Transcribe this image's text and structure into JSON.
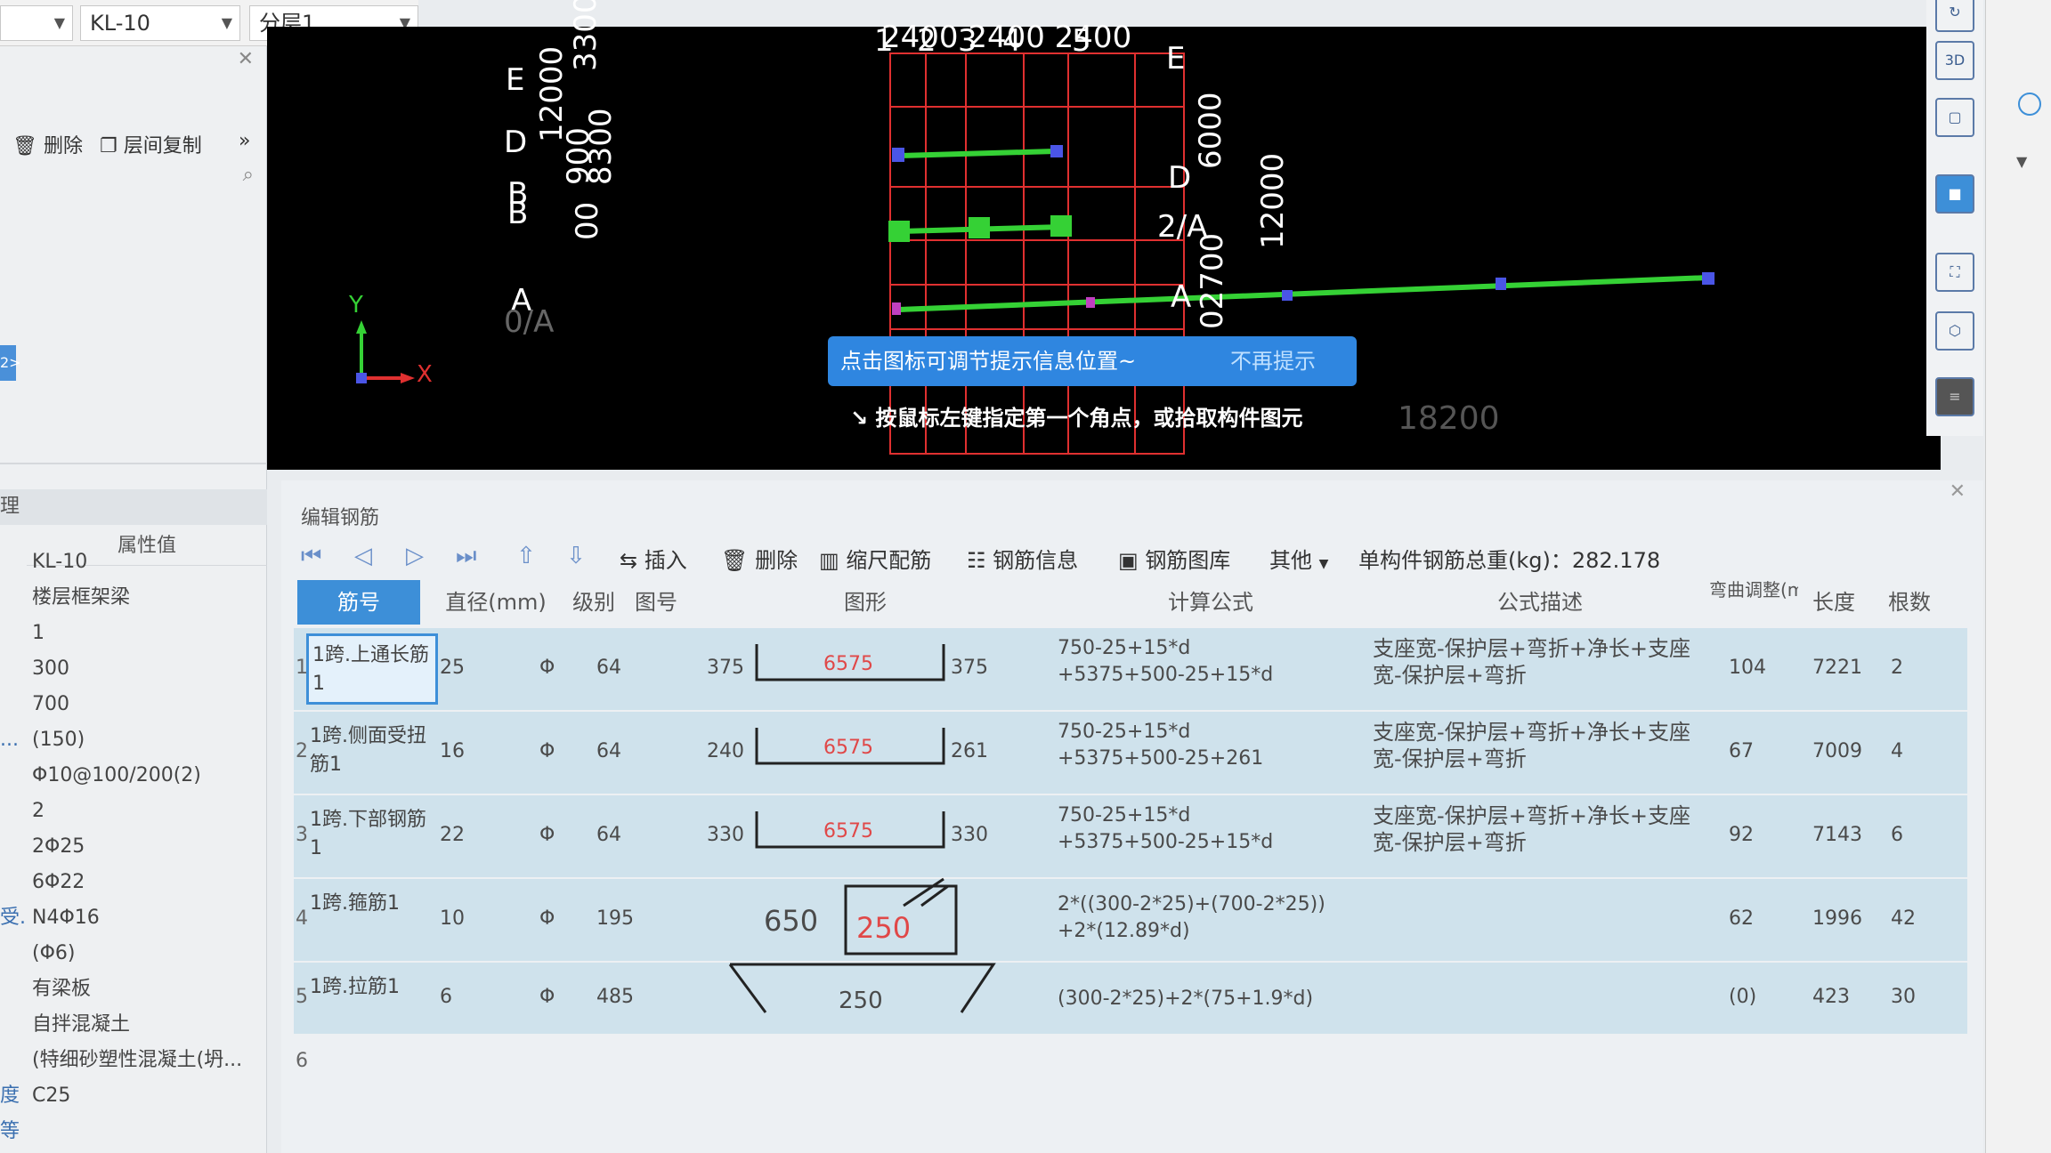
{
  "toolbar": {
    "combo_left_value": "",
    "combo_element": "KL-10",
    "combo_layer": "分层1"
  },
  "left_panel": {
    "delete_label": "删除",
    "copy_label": "层间复制",
    "tab_label": "2>",
    "section_label": "理",
    "col_header": "属性值",
    "properties": [
      {
        "label": "",
        "value": "KL-10"
      },
      {
        "label": "",
        "value": "楼层框架梁"
      },
      {
        "label": "",
        "value": "1"
      },
      {
        "label": "",
        "value": "300"
      },
      {
        "label": "",
        "value": "700"
      },
      {
        "label": "...",
        "value": "(150)"
      },
      {
        "label": "",
        "value": "Φ10@100/200(2)"
      },
      {
        "label": "",
        "value": "2"
      },
      {
        "label": "",
        "value": "2Φ25"
      },
      {
        "label": "",
        "value": "6Φ22"
      },
      {
        "label": "受...",
        "value": "N4Φ16"
      },
      {
        "label": "",
        "value": "(Φ6)"
      },
      {
        "label": "",
        "value": "有梁板"
      },
      {
        "label": "",
        "value": "自拌混凝土"
      },
      {
        "label": "",
        "value": "(特细砂塑性混凝土(坍..."
      },
      {
        "label": "度等级",
        "value": "C25"
      }
    ]
  },
  "cad": {
    "axis_top": [
      "1",
      "2",
      "3",
      "4",
      "5"
    ],
    "axis_top_text": "2400 2400 2400",
    "axis_left": [
      "E",
      "D",
      "B",
      "B",
      "A",
      "0/A"
    ],
    "axis_right": [
      "E",
      "D",
      "2/A",
      "A"
    ],
    "dims_left": [
      "3300",
      "12000",
      "900",
      "8300",
      "00"
    ],
    "dims_right": [
      "6000",
      "12000",
      "02700"
    ],
    "dim_bottom": "18200",
    "coord_y": "Y",
    "coord_x": "X"
  },
  "popup": {
    "message": "点击图标可调节提示信息位置~",
    "dismiss": "不再提示"
  },
  "status_hint": "按鼠标左键指定第一个角点，或拾取构件图元",
  "editor": {
    "title": "编辑钢筋",
    "tools": {
      "insert": "插入",
      "delete": "删除",
      "scale": "缩尺配筋",
      "info": "钢筋信息",
      "library": "钢筋图库",
      "other": "其他",
      "weight_label": "单构件钢筋总重(kg)：282.178"
    },
    "headers": {
      "bar_no": "筋号",
      "diameter": "直径(mm)",
      "grade": "级别",
      "fig_no": "图号",
      "shape": "图形",
      "formula": "计算公式",
      "desc": "公式描述",
      "bend": "弯曲调整(mm)",
      "length": "长度",
      "count": "根数"
    },
    "rows": [
      {
        "no": "1",
        "name": "1跨.上通长筋1",
        "dia": "25",
        "grade": "Φ",
        "fig": "64",
        "left": "375",
        "mid": "6575",
        "right": "375",
        "formula1": "750-25+15*d",
        "formula2": "+5375+500-25+15*d",
        "desc": "支座宽-保护层+弯折+净长+支座宽-保护层+弯折",
        "bend": "104",
        "length": "7221",
        "count": "2"
      },
      {
        "no": "2",
        "name": "1跨.侧面受扭筋1",
        "dia": "16",
        "grade": "Φ",
        "fig": "64",
        "left": "240",
        "mid": "6575",
        "right": "261",
        "formula1": "750-25+15*d",
        "formula2": "+5375+500-25+261",
        "desc": "支座宽-保护层+弯折+净长+支座宽-保护层+弯折",
        "bend": "67",
        "length": "7009",
        "count": "4"
      },
      {
        "no": "3",
        "name": "1跨.下部钢筋1",
        "dia": "22",
        "grade": "Φ",
        "fig": "64",
        "left": "330",
        "mid": "6575",
        "right": "330",
        "formula1": "750-25+15*d",
        "formula2": "+5375+500-25+15*d",
        "desc": "支座宽-保护层+弯折+净长+支座宽-保护层+弯折",
        "bend": "92",
        "length": "7143",
        "count": "6"
      },
      {
        "no": "4",
        "name": "1跨.箍筋1",
        "dia": "10",
        "grade": "Φ",
        "fig": "195",
        "left": "650",
        "mid": "250",
        "right": "",
        "formula1": "2*((300-2*25)+(700-2*25))",
        "formula2": "+2*(12.89*d)",
        "desc": "",
        "bend": "62",
        "length": "1996",
        "count": "42"
      },
      {
        "no": "5",
        "name": "1跨.拉筋1",
        "dia": "6",
        "grade": "Φ",
        "fig": "485",
        "left": "",
        "mid": "250",
        "right": "",
        "formula1": "(300-2*25)+2*(75+1.9*d)",
        "formula2": "",
        "desc": "",
        "bend": "(0)",
        "length": "423",
        "count": "30"
      }
    ],
    "empty_row_no": "6"
  }
}
